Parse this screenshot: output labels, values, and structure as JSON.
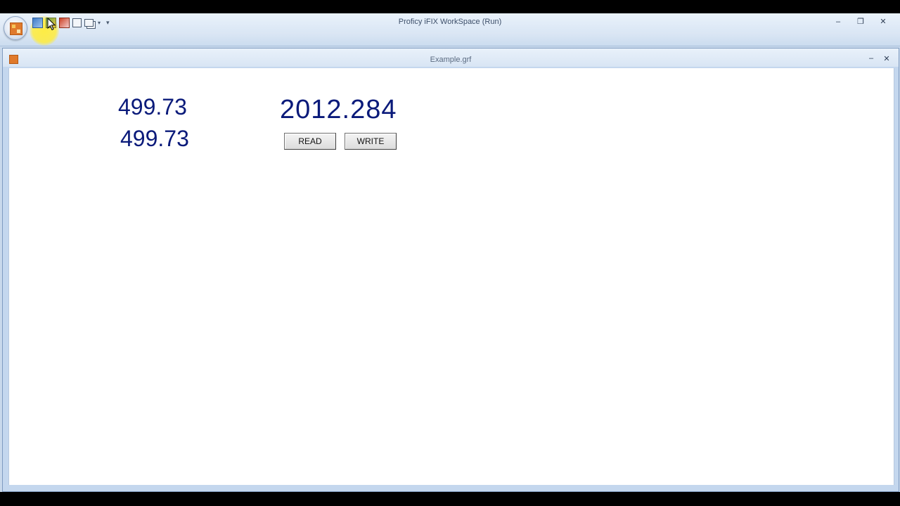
{
  "app": {
    "title": "Proficy iFIX WorkSpace (Run)",
    "window_controls": {
      "minimize": "–",
      "restore": "❐",
      "close": "✕"
    },
    "help_glyph": "?",
    "quick_access": {
      "icons": [
        "switch-to-configure-icon",
        "display-icon",
        "picture-icon",
        "select-icon",
        "window-icon"
      ],
      "dropdown_glyph": "▾",
      "customize_glyph": "▾"
    }
  },
  "document": {
    "title": "Example.grf",
    "controls": {
      "minimize": "–",
      "close": "✕"
    }
  },
  "canvas": {
    "values": {
      "value_1": "499.73",
      "value_2": "499.73",
      "value_3": "2012.284"
    },
    "buttons": {
      "read": "READ",
      "write": "WRITE"
    },
    "value_color": "#0a1a7a"
  },
  "colors": {
    "title_bar": "#dbe7f5",
    "canvas_bg": "#ffffff",
    "cursor_highlight": "#ffec3c"
  }
}
